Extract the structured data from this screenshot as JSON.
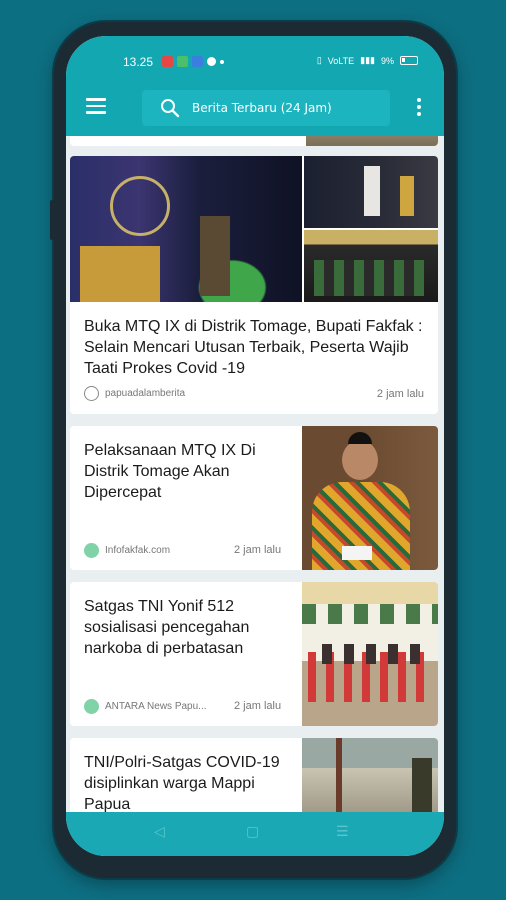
{
  "status": {
    "time": "13.25",
    "battery": "9%",
    "signal": "VoLTE"
  },
  "search": {
    "placeholder": "Berita Terbaru (24 Jam)"
  },
  "articles": [
    {
      "title": "Buka MTQ IX di Distrik Tomage, Bupati Fakfak : Selain Mencari Utusan Terbaik, Peserta Wajib Taati Prokes Covid -19",
      "source": "papuadalamberita",
      "time": "2 jam lalu"
    },
    {
      "title": "Pelaksanaan MTQ IX Di Distrik Tomage Akan Dipercepat",
      "source": "Infofakfak.com",
      "time": "2 jam lalu"
    },
    {
      "title": "Satgas TNI Yonif 512 sosialisasi pencegahan narkoba di perbatasan",
      "source": "ANTARA News Papu...",
      "time": "2 jam lalu"
    },
    {
      "title": "TNI/Polri-Satgas COVID-19 disiplinkan warga Mappi Papua",
      "source": "",
      "time": ""
    }
  ],
  "colors": {
    "appbar": "#13a7b2",
    "background": "#0d6f82"
  }
}
